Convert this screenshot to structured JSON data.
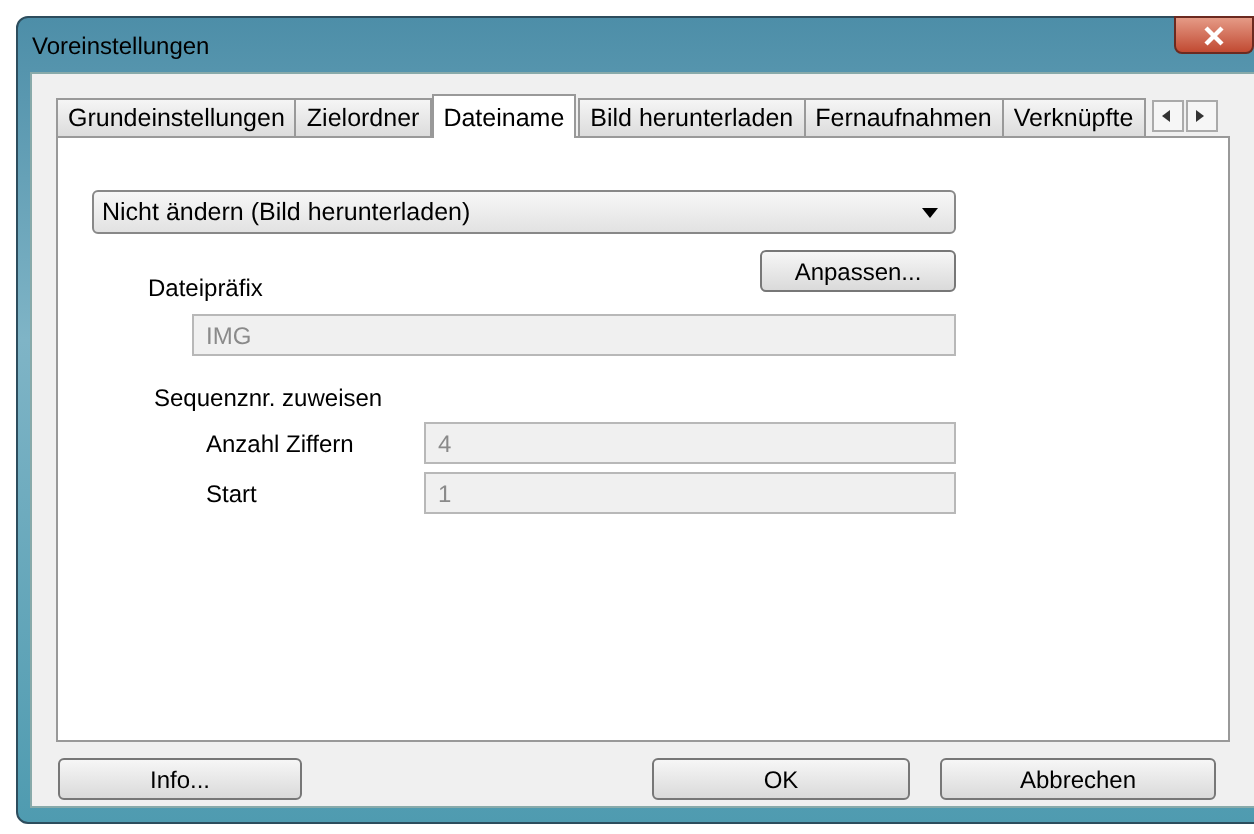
{
  "window": {
    "title": "Voreinstellungen"
  },
  "tabs": [
    {
      "label": "Grundeinstellungen",
      "selected": false
    },
    {
      "label": "Zielordner",
      "selected": false
    },
    {
      "label": "Dateiname",
      "selected": true
    },
    {
      "label": "Bild herunterladen",
      "selected": false
    },
    {
      "label": "Fernaufnahmen",
      "selected": false
    },
    {
      "label": "Verknüpfte",
      "selected": false
    }
  ],
  "dropdown": {
    "value": "Nicht ändern (Bild herunterladen)"
  },
  "customize_button": "Anpassen...",
  "prefix": {
    "label": "Dateipräfix",
    "value": "IMG",
    "disabled": true
  },
  "sequence": {
    "label": "Sequenznr. zuweisen",
    "fields": [
      {
        "label": "Anzahl Ziffern",
        "value": "4",
        "disabled": true
      },
      {
        "label": "Start",
        "value": "1",
        "disabled": true
      }
    ]
  },
  "buttons": {
    "info": "Info...",
    "ok": "OK",
    "cancel": "Abbrechen"
  }
}
